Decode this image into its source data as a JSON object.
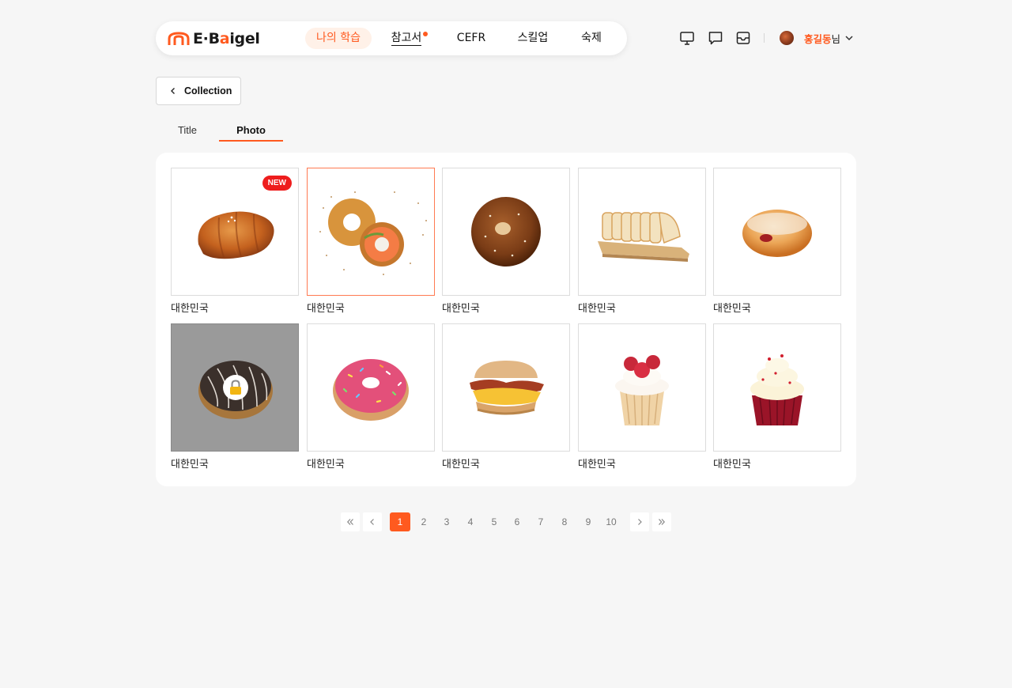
{
  "brand": {
    "logo_text_prefix": "E·B",
    "logo_text_o": "a",
    "logo_text_rest": "igel",
    "accent": "#ff5a1f"
  },
  "nav": {
    "items": [
      {
        "label": "나의 학습",
        "active": true
      },
      {
        "label": "참고서",
        "has_dot": true
      },
      {
        "label": "CEFR"
      },
      {
        "label": "스킬업"
      },
      {
        "label": "숙제"
      }
    ]
  },
  "header": {
    "icons": [
      "monitor-icon",
      "chat-icon",
      "inbox-icon"
    ],
    "user_name": "홍길동",
    "user_suffix": "님"
  },
  "back_button": {
    "label": "Collection"
  },
  "tabs": [
    {
      "label": "Title",
      "active": false
    },
    {
      "label": "Photo",
      "active": true
    }
  ],
  "gallery": {
    "items": [
      {
        "caption": "대한민국",
        "image": "croissant-roll",
        "badge": "NEW"
      },
      {
        "caption": "대한민국",
        "image": "salmon-bagel",
        "selected": true
      },
      {
        "caption": "대한민국",
        "image": "bagel"
      },
      {
        "caption": "대한민국",
        "image": "sliced-bread"
      },
      {
        "caption": "대한민국",
        "image": "jam-doughnut"
      },
      {
        "caption": "대한민국",
        "image": "chocolate-doughnut",
        "locked": true
      },
      {
        "caption": "대한민국",
        "image": "sprinkle-doughnut"
      },
      {
        "caption": "대한민국",
        "image": "breakfast-muffin-sandwich"
      },
      {
        "caption": "대한민국",
        "image": "raspberry-cupcake"
      },
      {
        "caption": "대한민국",
        "image": "red-velvet-cupcake"
      }
    ]
  },
  "pagination": {
    "current": 1,
    "pages": [
      "1",
      "2",
      "3",
      "4",
      "5",
      "6",
      "7",
      "8",
      "9",
      "10"
    ]
  }
}
